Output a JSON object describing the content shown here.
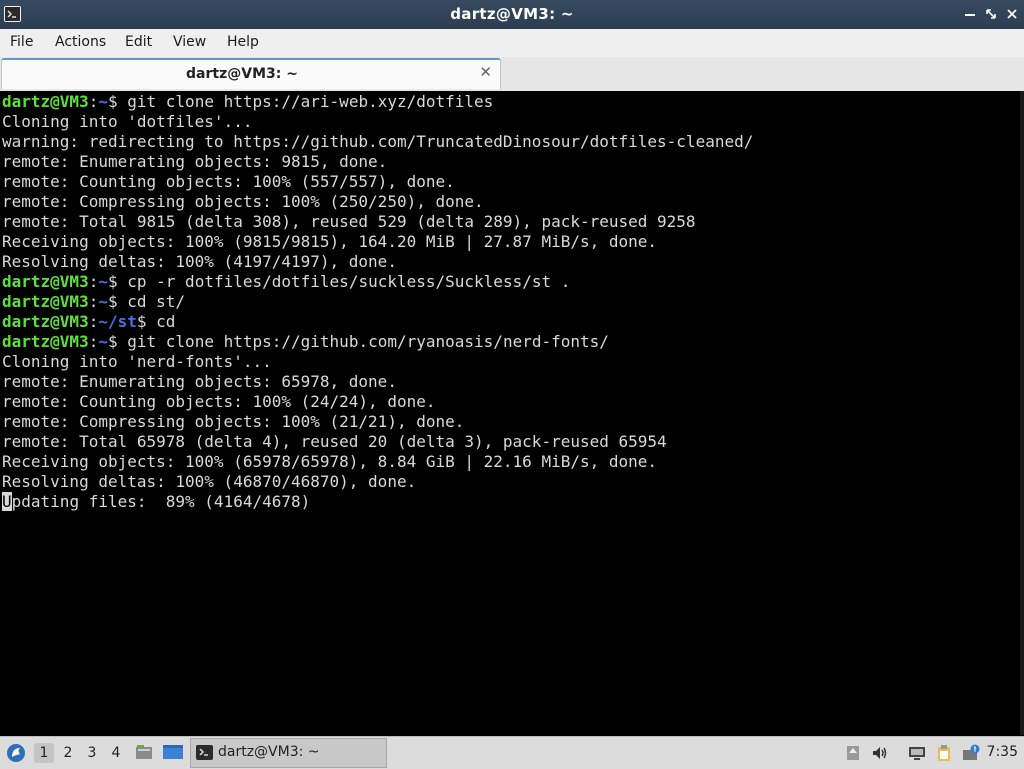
{
  "window": {
    "title": "dartz@VM3: ~",
    "minimize_glyph": "▁",
    "maximize_glyph": "⤢",
    "close_glyph": "✕"
  },
  "menu": {
    "file": "File",
    "actions": "Actions",
    "edit": "Edit",
    "view": "View",
    "help": "Help"
  },
  "tab": {
    "label": "dartz@VM3: ~",
    "close_glyph": "✕"
  },
  "terminal": {
    "lines": [
      {
        "prompt": true,
        "user": "dartz@VM3",
        "path": "~",
        "cmd": " git clone https://ari-web.xyz/dotfiles"
      },
      {
        "text": "Cloning into 'dotfiles'..."
      },
      {
        "text": "warning: redirecting to https://github.com/TruncatedDinosour/dotfiles-cleaned/"
      },
      {
        "text": "remote: Enumerating objects: 9815, done."
      },
      {
        "text": "remote: Counting objects: 100% (557/557), done."
      },
      {
        "text": "remote: Compressing objects: 100% (250/250), done."
      },
      {
        "text": "remote: Total 9815 (delta 308), reused 529 (delta 289), pack-reused 9258"
      },
      {
        "text": "Receiving objects: 100% (9815/9815), 164.20 MiB | 27.87 MiB/s, done."
      },
      {
        "text": "Resolving deltas: 100% (4197/4197), done."
      },
      {
        "prompt": true,
        "user": "dartz@VM3",
        "path": "~",
        "cmd": " cp -r dotfiles/dotfiles/suckless/Suckless/st ."
      },
      {
        "prompt": true,
        "user": "dartz@VM3",
        "path": "~",
        "cmd": " cd st/"
      },
      {
        "prompt": true,
        "user": "dartz@VM3",
        "path": "~/st",
        "cmd": " cd"
      },
      {
        "prompt": true,
        "user": "dartz@VM3",
        "path": "~",
        "cmd": " git clone https://github.com/ryanoasis/nerd-fonts/"
      },
      {
        "text": "Cloning into 'nerd-fonts'..."
      },
      {
        "text": "remote: Enumerating objects: 65978, done."
      },
      {
        "text": "remote: Counting objects: 100% (24/24), done."
      },
      {
        "text": "remote: Compressing objects: 100% (21/21), done."
      },
      {
        "text": "remote: Total 65978 (delta 4), reused 20 (delta 3), pack-reused 65954"
      },
      {
        "text": "Receiving objects: 100% (65978/65978), 8.84 GiB | 22.16 MiB/s, done."
      },
      {
        "text": "Resolving deltas: 100% (46870/46870), done."
      },
      {
        "cursor_char": "U",
        "text": "pdating files:  89% (4164/4678)"
      }
    ]
  },
  "taskbar": {
    "desktops": [
      "1",
      "2",
      "3",
      "4"
    ],
    "active_desktop": "1",
    "task_label": "dartz@VM3: ~",
    "clock": "7:35"
  },
  "colors": {
    "prompt_user": "#5ce03b",
    "prompt_path": "#4b6fe8",
    "terminal_fg": "#d9d9d9",
    "titlebar": "#2d3e51"
  }
}
